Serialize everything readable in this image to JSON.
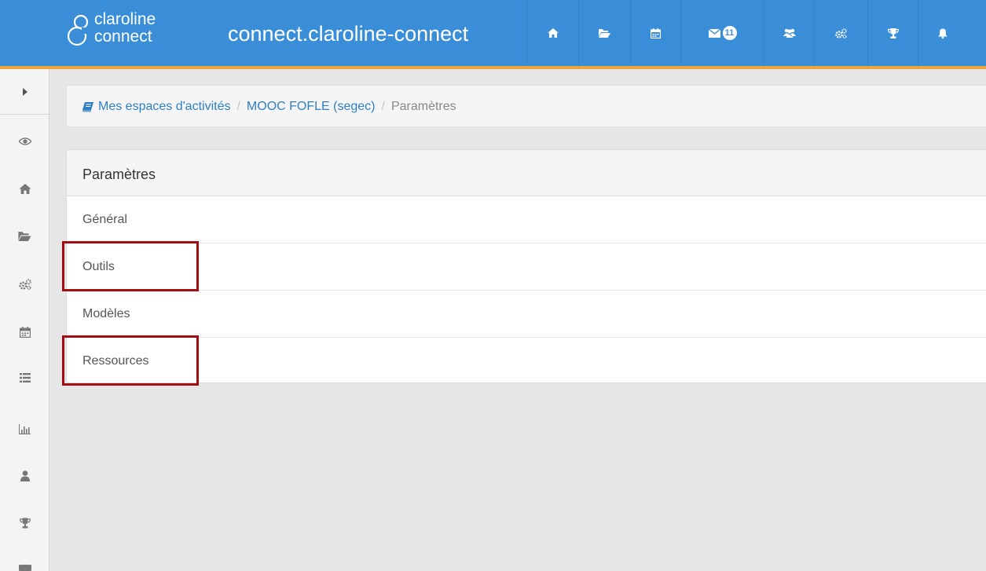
{
  "header": {
    "logo_line1": "claroline",
    "logo_line2": "connect",
    "site_name": "connect.claroline-connect",
    "nav": [
      {
        "icon": "home-icon"
      },
      {
        "icon": "folder-open-icon"
      },
      {
        "icon": "calendar-icon"
      },
      {
        "icon": "envelope-icon",
        "badge": "11"
      },
      {
        "icon": "users-icon"
      },
      {
        "icon": "cogs-icon"
      },
      {
        "icon": "trophy-icon"
      },
      {
        "icon": "bell-icon"
      }
    ],
    "accent_color": "#3a8ed8",
    "border_color": "#f0a23c"
  },
  "sidebar": {
    "items": [
      {
        "icon": "caret-right-icon"
      },
      {
        "icon": "eye-icon"
      },
      {
        "icon": "home-icon"
      },
      {
        "icon": "folder-open-icon"
      },
      {
        "icon": "cogs-icon"
      },
      {
        "icon": "calendar-icon"
      },
      {
        "icon": "list-icon"
      },
      {
        "icon": "bar-chart-icon"
      },
      {
        "icon": "user-icon"
      },
      {
        "icon": "trophy-icon"
      },
      {
        "icon": "keyboard-icon"
      }
    ]
  },
  "breadcrumb": {
    "icon": "book-icon",
    "items": [
      "Mes espaces d'activités",
      "MOOC FOFLE (segec)",
      "Paramètres"
    ],
    "separator": "/"
  },
  "panel": {
    "title": "Paramètres",
    "items": [
      "Général",
      "Outils",
      "Modèles",
      "Ressources"
    ],
    "highlighted": [
      "Outils",
      "Ressources"
    ],
    "highlight_color": "#a60d12"
  }
}
